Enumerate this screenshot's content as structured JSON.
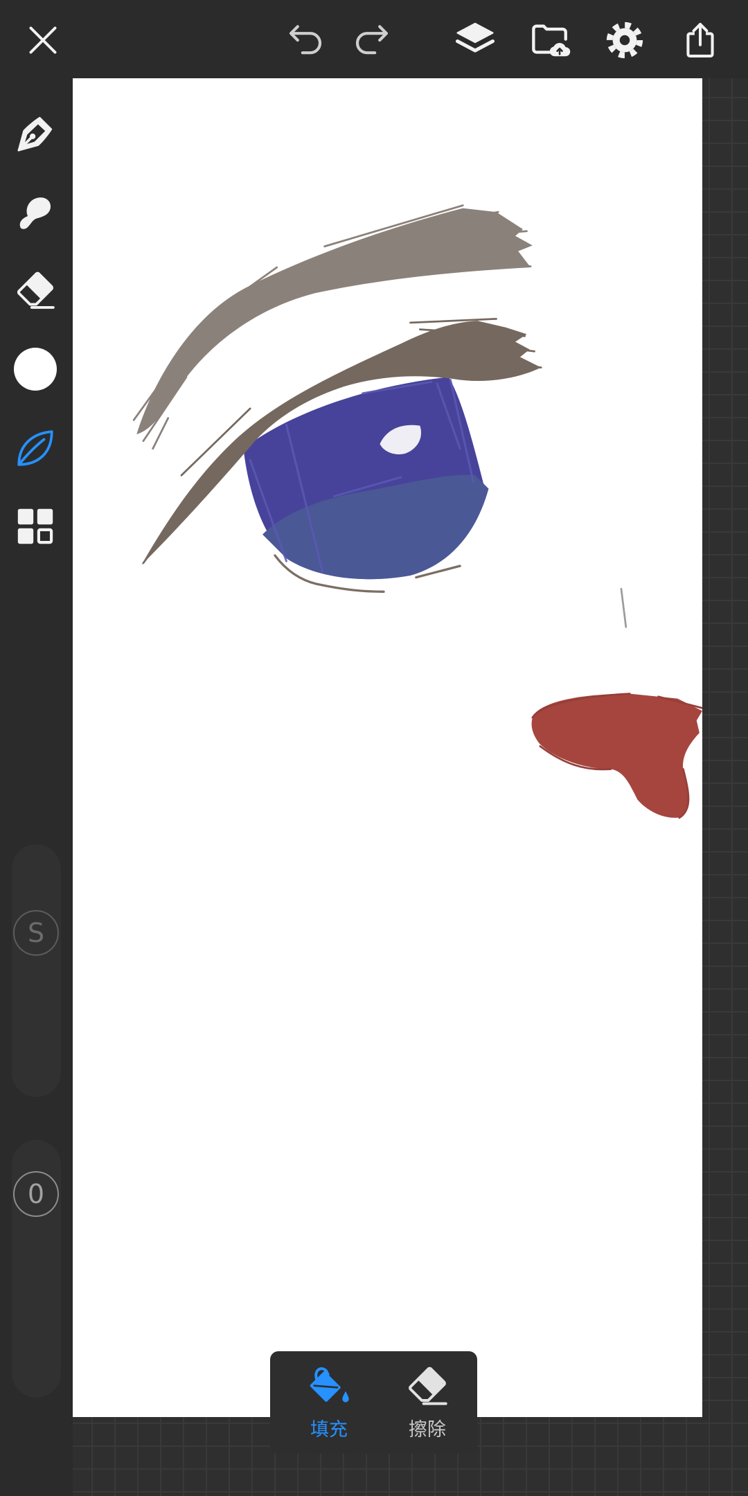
{
  "toolbar": {
    "close": {
      "icon": "close-icon"
    },
    "undo": {
      "icon": "undo-icon"
    },
    "redo": {
      "icon": "redo-icon"
    },
    "layers": {
      "icon": "layers-icon"
    },
    "gallery": {
      "icon": "folder-sync-icon"
    },
    "settings": {
      "icon": "gear-icon"
    },
    "share": {
      "icon": "share-icon"
    }
  },
  "sidebar": {
    "tools": [
      {
        "icon": "pen-nib-icon"
      },
      {
        "icon": "smudge-brush-icon"
      },
      {
        "icon": "eraser-icon"
      },
      {
        "icon": "color-swatch-icon",
        "color": "#ffffff"
      },
      {
        "icon": "leaf-brush-icon",
        "selected": true
      },
      {
        "icon": "grid-icon"
      }
    ],
    "size_slider": {
      "label": "S"
    },
    "opacity_slider": {
      "label": "0"
    }
  },
  "fill_menu": {
    "options": [
      {
        "label": "填充",
        "icon": "paint-bucket-icon",
        "selected": true
      },
      {
        "label": "擦除",
        "icon": "eraser-icon",
        "selected": false
      }
    ]
  },
  "theme": {
    "accent": "#2691ff",
    "chrome": "#2b2b2b",
    "panel": "#2e2e2e",
    "canvas": "#ffffff"
  },
  "drawing": {
    "colors": {
      "eyebrow": "#8a817a",
      "eyelid": "#75685f",
      "iris": "#47439a",
      "iris_lower": "#4a5896",
      "iris_light": "#5b59b3",
      "highlight": "#eeeef4",
      "lash_line": "#7b6e65",
      "nose_line": "#9c9c9c",
      "lips": "#a6453e",
      "lips_dark": "#963f39"
    }
  }
}
